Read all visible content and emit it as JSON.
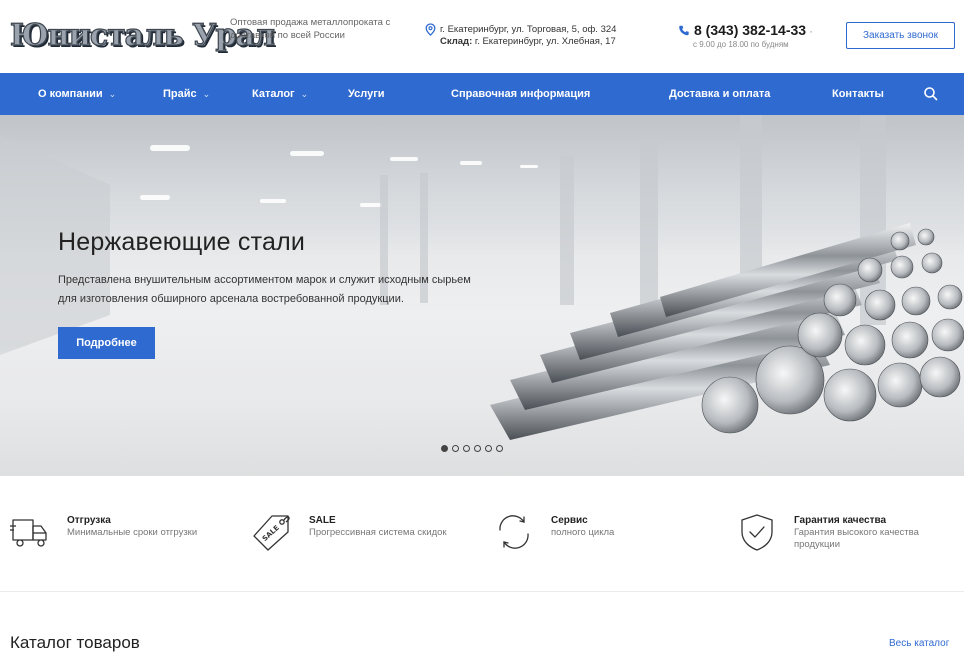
{
  "header": {
    "logo_text": "Юнисталь Урал",
    "tagline": "Оптовая продажа металлопроката с доставкой по всей России",
    "address": {
      "office": "г. Екатеринбург, ул. Торговая, 5, оф. 324",
      "warehouse_label": "Склад:",
      "warehouse": "г. Екатеринбург, ул. Хлебная, 17"
    },
    "phone": "8 (343) 382-14-33",
    "phone_dot": "·",
    "hours": "с 9.00 до 18.00 по будням",
    "callback_label": "Заказать звонок"
  },
  "nav": {
    "items": [
      {
        "label": "О компании",
        "dropdown": true
      },
      {
        "label": "Прайс",
        "dropdown": true
      },
      {
        "label": "Каталог",
        "dropdown": true
      },
      {
        "label": "Услуги",
        "dropdown": false
      },
      {
        "label": "Справочная информация",
        "dropdown": false
      },
      {
        "label": "Доставка и оплата",
        "dropdown": false
      },
      {
        "label": "Контакты",
        "dropdown": false
      }
    ],
    "search_icon": "search-icon",
    "chevron": "⌄"
  },
  "hero": {
    "title": "Нержавеющие стали",
    "description": "Представлена внушительным ассортиментом марок и служит исходным сырьем для изготовления обширного арсенала востребованной продукции.",
    "button_label": "Подробнее",
    "slides_total": 6,
    "active_slide": 1
  },
  "features": [
    {
      "icon": "truck-icon",
      "title": "Отгрузка",
      "subtitle": "Минимальные сроки отгрузки"
    },
    {
      "icon": "sale-tag-icon",
      "title": "SALE",
      "subtitle": "Прогрессивная система скидок"
    },
    {
      "icon": "refresh-icon",
      "title": "Сервис",
      "subtitle": "полного цикла"
    },
    {
      "icon": "shield-check-icon",
      "title": "Гарантия качества",
      "subtitle": "Гарантия высокого качества продукции"
    }
  ],
  "catalog": {
    "title": "Каталог товаров",
    "all_link": "Весь каталог"
  },
  "colors": {
    "primary": "#2f6ad0",
    "text": "#222222",
    "muted": "#777777"
  }
}
